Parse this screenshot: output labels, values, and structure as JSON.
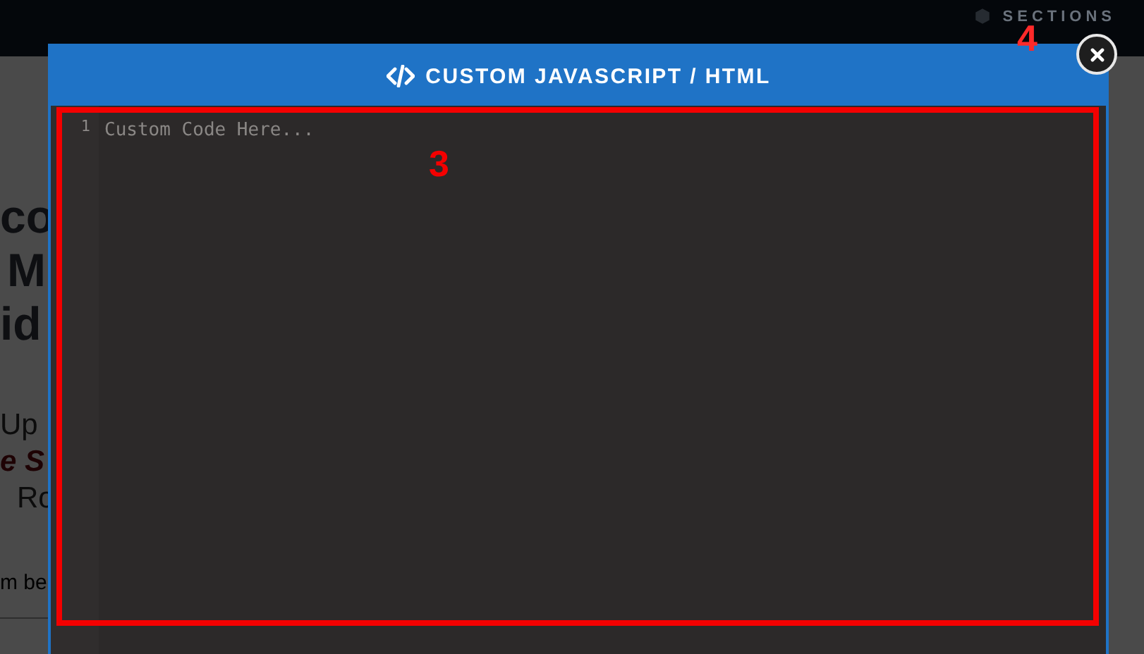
{
  "top_bar": {
    "sections_label": "SECTIONS"
  },
  "background_page": {
    "heading_lines": [
      "co",
      "M",
      "id"
    ],
    "subtitle_lines": [
      {
        "kind": "plain",
        "text": "Up"
      },
      {
        "kind": "emphasis",
        "text": "e S"
      },
      {
        "kind": "plain",
        "text": "Ro"
      }
    ],
    "footer_text": "m be"
  },
  "modal": {
    "title": "CUSTOM JAVASCRIPT / HTML",
    "editor": {
      "line_numbers": [
        "1"
      ],
      "placeholder": "Custom Code Here..."
    }
  },
  "annotations": [
    {
      "label": "3"
    },
    {
      "label": "4"
    }
  ]
}
